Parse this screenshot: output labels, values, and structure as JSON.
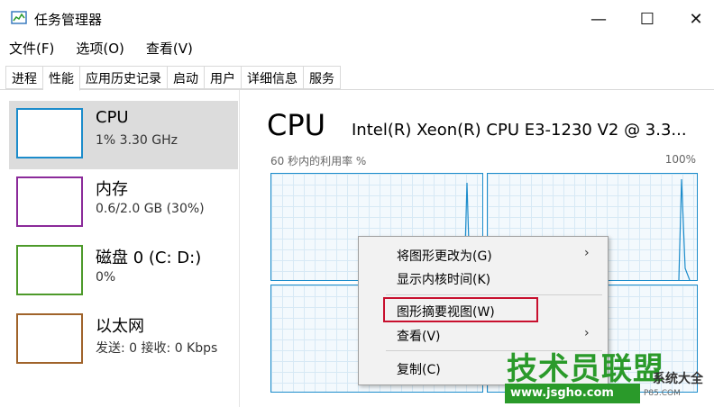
{
  "window": {
    "title": "任务管理器",
    "minimize_glyph": "—",
    "maximize_glyph": "☐",
    "close_glyph": "✕"
  },
  "menubar": {
    "items": [
      {
        "label": "文件(F)"
      },
      {
        "label": "选项(O)"
      },
      {
        "label": "查看(V)"
      }
    ]
  },
  "tabs": [
    {
      "label": "进程"
    },
    {
      "label": "性能"
    },
    {
      "label": "应用历史记录"
    },
    {
      "label": "启动"
    },
    {
      "label": "用户"
    },
    {
      "label": "详细信息"
    },
    {
      "label": "服务"
    }
  ],
  "active_tab": "性能",
  "sidebar": {
    "items": [
      {
        "name": "CPU",
        "detail": "1% 3.30 GHz",
        "color": "#1c8ccb"
      },
      {
        "name": "内存",
        "detail": "0.6/2.0 GB (30%)",
        "color": "#8b2a9a"
      },
      {
        "name": "磁盘 0 (C: D:)",
        "detail": "0%",
        "color": "#4d9a2a"
      },
      {
        "name": "以太网",
        "detail": "发送: 0 接收: 0 Kbps",
        "color": "#a0632a"
      }
    ]
  },
  "main": {
    "title": "CPU",
    "model": "Intel(R) Xeon(R) CPU E3-1230 V2 @ 3.3...",
    "util_label": "60 秒内的利用率 %",
    "util_max": "100%"
  },
  "context_menu": {
    "items": [
      {
        "label": "将图形更改为(G)",
        "submenu": true
      },
      {
        "label": "显示内核时间(K)",
        "submenu": false
      },
      {
        "label": "图形摘要视图(W)",
        "submenu": false,
        "highlighted": true
      },
      {
        "label": "查看(V)",
        "submenu": true
      },
      {
        "label": "复制(C)",
        "submenu": false
      }
    ],
    "submenu_glyph": "›"
  },
  "watermark": {
    "title": "技术员联盟",
    "subtitle": "系统大全",
    "url": "www.jsgho.com",
    "url2": "P85.COM"
  },
  "colors": {
    "graph_border": "#1c8ccb",
    "highlight_box": "#c8102e",
    "selected_bg": "#dcdcdc"
  }
}
